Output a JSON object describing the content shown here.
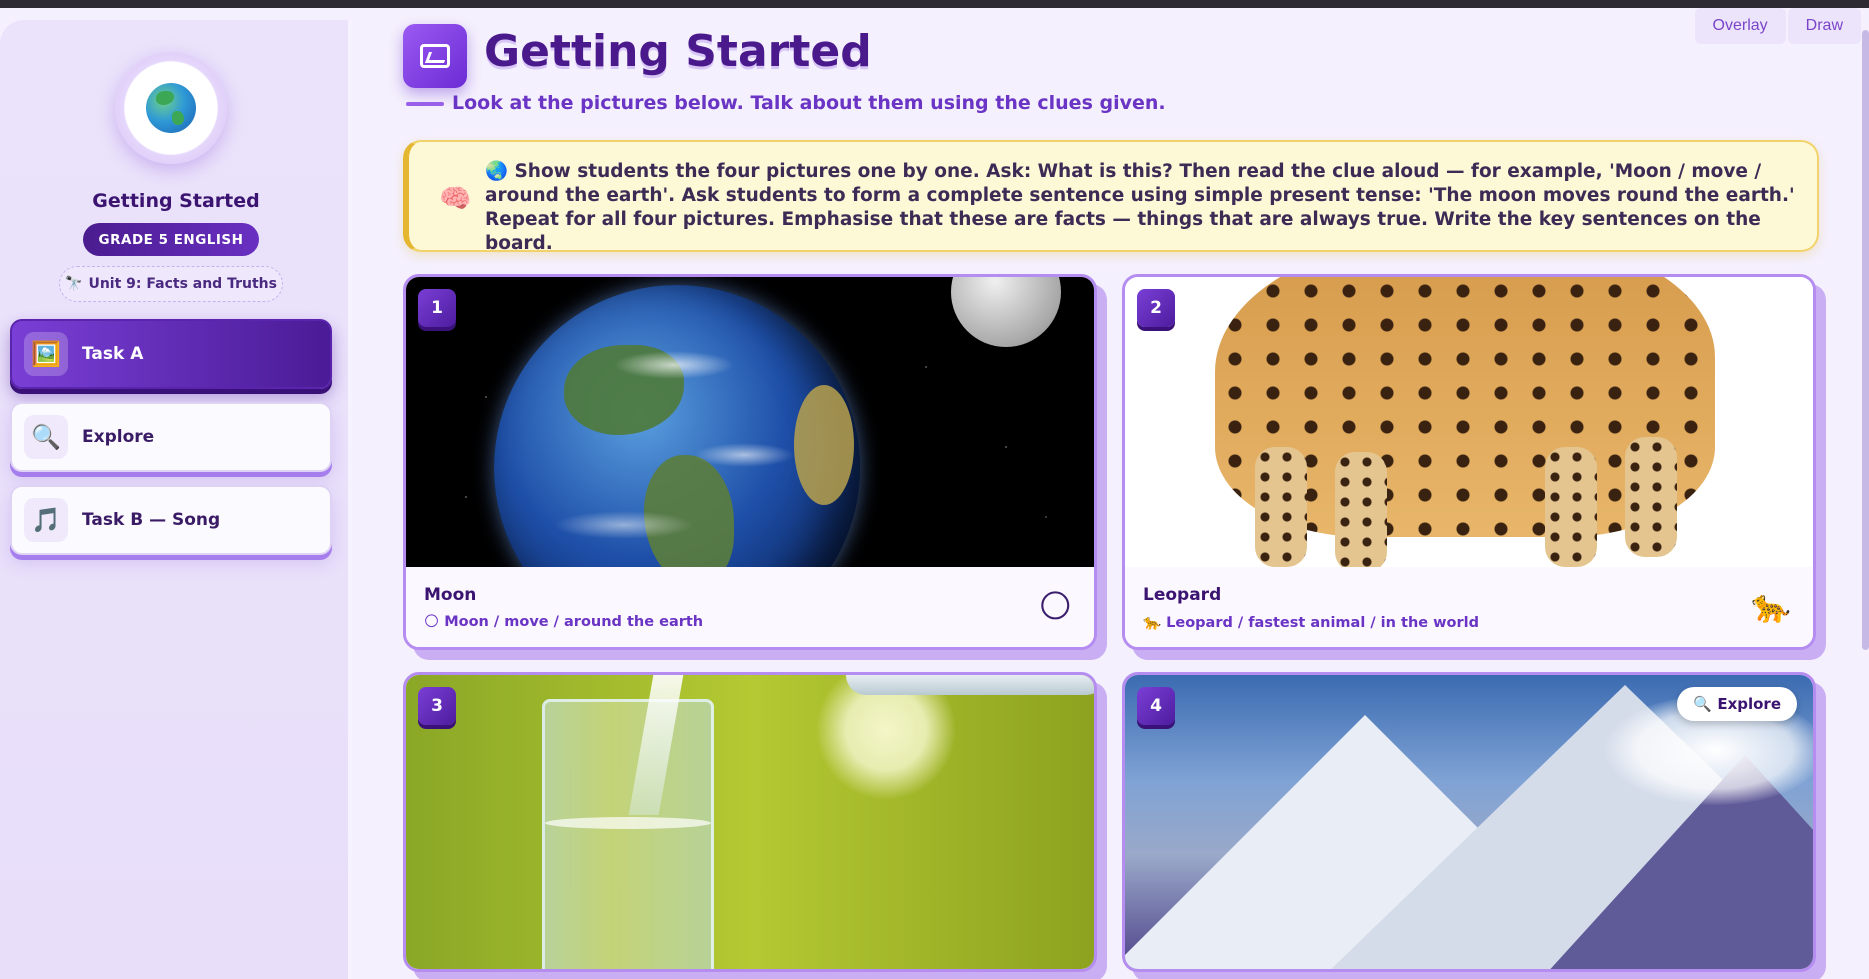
{
  "overlay": {
    "overlay_label": "Overlay",
    "draw_label": "Draw"
  },
  "sidebar": {
    "title": "Getting Started",
    "grade": "GRADE 5 ENGLISH",
    "unit_icon": "🔭",
    "unit": "Unit 9: Facts and Truths",
    "items": [
      {
        "label": "Task A",
        "icon": "🖼️",
        "active": true
      },
      {
        "label": "Explore",
        "icon": "🔍",
        "active": false
      },
      {
        "label": "Task B — Song",
        "icon": "🎵",
        "active": false
      }
    ]
  },
  "header": {
    "title": "Getting Started",
    "subtitle": "Look at the pictures below. Talk about them using the clues given."
  },
  "tip": {
    "icon": "🧠",
    "text": "🌏 Show students the four pictures one by one. Ask: What is this? Then read the clue aloud — for example, 'Moon / move / around the earth'. Ask students to form a complete sentence using simple present tense: 'The moon moves round the earth.' Repeat for all four pictures. Emphasise that these are facts — things that are always true. Write the key sentences on the board."
  },
  "cards": [
    {
      "num": "1",
      "name": "Moon",
      "clue_icon": "🌕",
      "clue": "Moon / move / around the earth",
      "emoji": "🌕"
    },
    {
      "num": "2",
      "name": "Leopard",
      "clue_icon": "🐆",
      "clue": "Leopard / fastest animal / in the world",
      "emoji": "🐆"
    },
    {
      "num": "3"
    },
    {
      "num": "4",
      "explore_label": "🔍 Explore"
    }
  ],
  "colors": {
    "accent": "#6b2bd4",
    "tip_bg": "#fdf8d6",
    "tip_border": "#e5b630"
  }
}
